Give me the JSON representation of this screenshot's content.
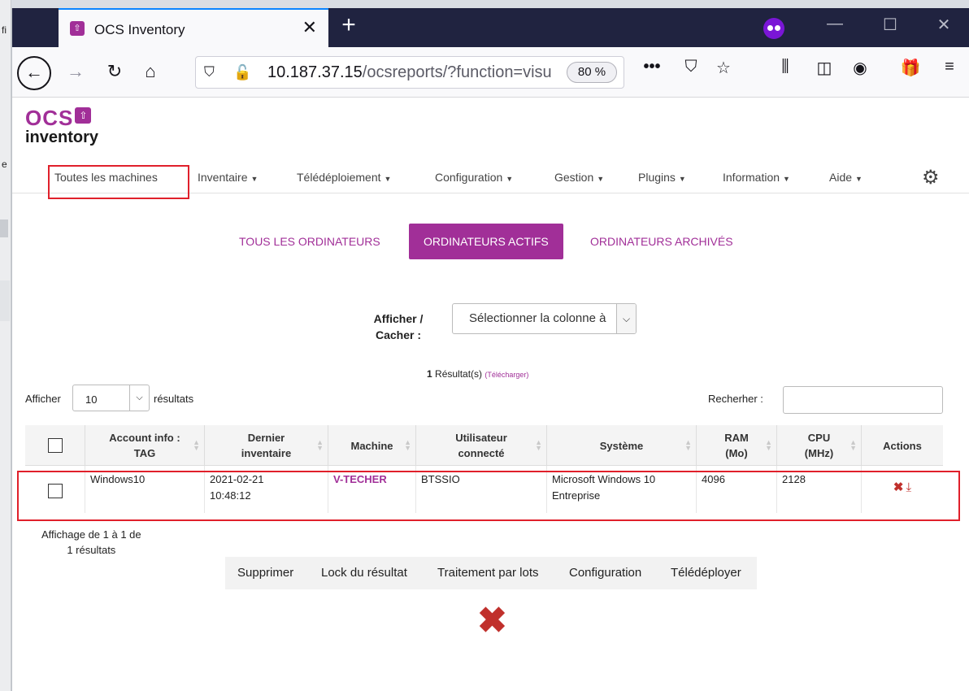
{
  "browser": {
    "tab_title": "OCS Inventory",
    "url_main": "10.187.37.15",
    "url_rest": "/ocsreports/?function=visu",
    "zoom": "80 %",
    "overflow": "•••"
  },
  "left_fragments": [
    "fi",
    "e"
  ],
  "logo": {
    "ocs": "OCS",
    "inventory": "inventory"
  },
  "menu": {
    "all_machines": "Toutes les machines",
    "items": [
      "Inventaire",
      "Télédéploiement",
      "Configuration",
      "Gestion",
      "Plugins",
      "Information",
      "Aide"
    ]
  },
  "filter_tabs": [
    "TOUS LES ORDINATEURS",
    "ORDINATEURS ACTIFS",
    "ORDINATEURS ARCHIVÉS"
  ],
  "columns_toggle": {
    "label_line1": "Afficher /",
    "label_line2": "Cacher :",
    "placeholder": "Sélectionner la colonne à"
  },
  "results": {
    "count": "1",
    "label": "Résultat(s)",
    "download": "(Télécharger)"
  },
  "length": {
    "before": "Afficher",
    "value": "10",
    "after": "résultats"
  },
  "search": {
    "label": "Recherher :",
    "value": ""
  },
  "table": {
    "headers": [
      {
        "line1": "Account info :",
        "line2": "TAG"
      },
      {
        "line1": "Dernier",
        "line2": "inventaire"
      },
      {
        "line1": "Machine",
        "line2": ""
      },
      {
        "line1": "Utilisateur",
        "line2": "connecté"
      },
      {
        "line1": "Système",
        "line2": ""
      },
      {
        "line1": "RAM",
        "line2": "(Mo)"
      },
      {
        "line1": "CPU",
        "line2": "(MHz)"
      },
      {
        "line1": "Actions",
        "line2": ""
      }
    ],
    "rows": [
      {
        "tag": "Windows10",
        "last_inventory_date": "2021-02-21",
        "last_inventory_time": "10:48:12",
        "machine": "V-TECHER",
        "user": "BTSSIO",
        "system_line1": "Microsoft Windows 10",
        "system_line2": "Entreprise",
        "ram": "4096",
        "cpu": "2128"
      }
    ]
  },
  "info": {
    "line1": "Affichage de 1 à 1 de",
    "line2": "1 résultats"
  },
  "bulk_actions": [
    "Supprimer",
    "Lock du résultat",
    "Traitement par lots",
    "Configuration",
    "Télédéployer"
  ],
  "colors": {
    "accent": "#a12f98",
    "highlight": "#e0202b",
    "delete": "#c0302c",
    "tabstrip": "#202340"
  }
}
